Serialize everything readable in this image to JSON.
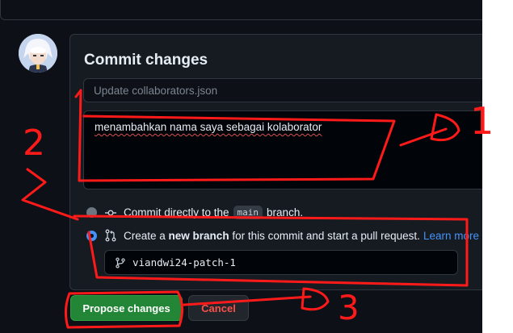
{
  "commit_form": {
    "title": "Commit changes",
    "summary_placeholder": "Update collaborators.json",
    "description_value": "menambahkan nama saya sebagai kolaborator",
    "option_direct": {
      "prefix": "Commit directly to the",
      "branch": "main",
      "suffix": "branch."
    },
    "option_new": {
      "prefix": "Create a",
      "bold": "new branch",
      "suffix": "for this commit and start a pull request.",
      "link": "Learn more"
    },
    "new_branch_name": "viandwi24-patch-1",
    "selected_option": "new-branch"
  },
  "actions": {
    "propose_label": "Propose changes",
    "cancel_label": "Cancel"
  },
  "annotations": {
    "marks": [
      "1",
      "2",
      "3"
    ],
    "color": "#ff1a1a"
  },
  "icons": {
    "commit": "git-commit-icon",
    "pull_request": "git-pull-request-icon",
    "branch": "git-branch-icon"
  },
  "colors": {
    "background": "#0d1117",
    "accent_blue": "#4493f8",
    "primary_green": "#238636",
    "danger": "#f85149"
  }
}
